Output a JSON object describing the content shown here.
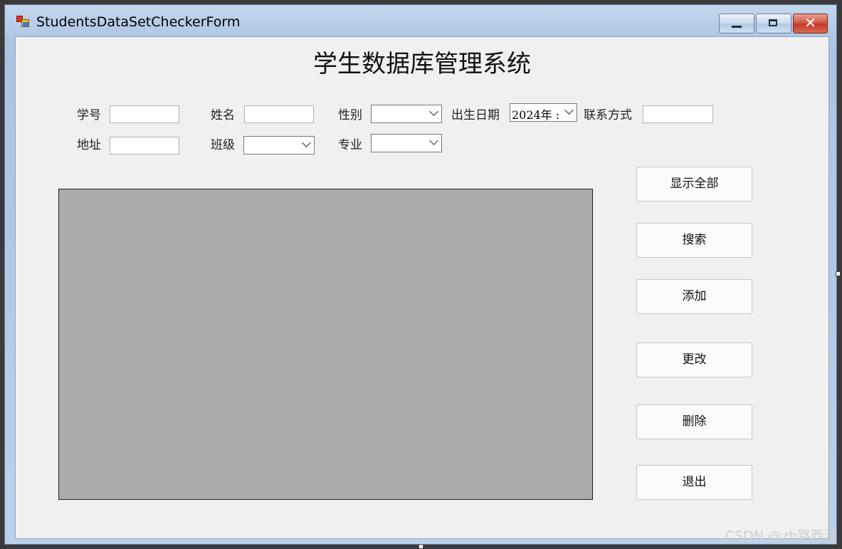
{
  "window": {
    "title": "StudentsDataSetCheckerForm"
  },
  "form": {
    "heading": "学生数据库管理系统",
    "fields": {
      "student_id_label": "学号",
      "name_label": "姓名",
      "gender_label": "性别",
      "birthdate_label": "出生日期",
      "birthdate_value": "2024年 :",
      "contact_label": "联系方式",
      "address_label": "地址",
      "class_label": "班级",
      "major_label": "专业"
    },
    "buttons": {
      "show_all": "显示全部",
      "search": "搜索",
      "add": "添加",
      "modify": "更改",
      "delete": "删除",
      "exit": "退出"
    }
  },
  "watermark": "CSDN @zh路西法",
  "colors": {
    "client_bg": "#f0f0f0",
    "grid_bg": "#ababab",
    "title_gradient": "#a9c3e2"
  }
}
